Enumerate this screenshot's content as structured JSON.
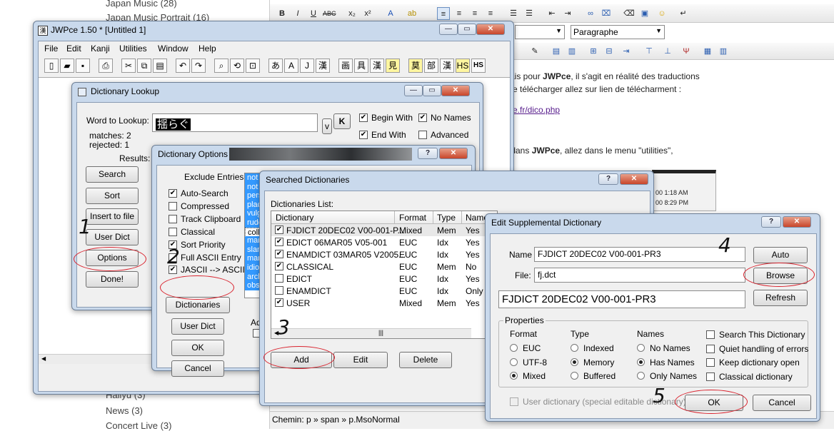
{
  "blog": {
    "categories": [
      "Japan Music (28)",
      "Japan Music Portrait (16)",
      "Hallyu (3)",
      "News (3)",
      "Concert Live (3)"
    ],
    "paragraph_select": "Paragraphe",
    "line1_pre": "çais pour ",
    "line1_bold": "JWPce",
    "line1_post": ", il s'agit en réalité des traductions",
    "line2": "r le télécharger allez sur lien de télécharment :",
    "link": "e.fr/dico.php",
    "line3_pre": "r dans ",
    "line3_bold": "JWPce",
    "line3_post": ", allez dans le menu \"utilities\",",
    "time1": "00 1:18 AM",
    "time2": "00 8:29 PM",
    "status": "Chemin: p » span » p.MsoNormal"
  },
  "jwpce": {
    "title": "JWPce 1.50 * [Untitled 1]",
    "menu": [
      "File",
      "Edit",
      "Kanji",
      "Utilities",
      "Window",
      "Help"
    ],
    "toolbar_kana": [
      "あ",
      "A",
      "J",
      "漢",
      "画",
      "具",
      "漢",
      "見",
      "莫",
      "部",
      "漢",
      "HS"
    ]
  },
  "lookup": {
    "title": "Dictionary Lookup",
    "word_label": "Word to Lookup:",
    "word_value": "揺らぐ",
    "matches": "matches: 2",
    "rejected": "rejected: 1",
    "results": "Results:",
    "v_label": "v",
    "k_label": "K",
    "begin_with": "Begin With",
    "no_names": "No Names",
    "end_with": "End With",
    "advanced": "Advanced",
    "buttons": [
      "Search",
      "Sort",
      "Insert to file",
      "User Dict",
      "Options",
      "Done!"
    ]
  },
  "options": {
    "title": "Dictionary Options",
    "exclude": "Exclude Entries:",
    "checks": [
      {
        "label": "Auto-Search",
        "checked": true
      },
      {
        "label": "Compressed",
        "checked": false
      },
      {
        "label": "Track Clipboard",
        "checked": false
      },
      {
        "label": "Classical",
        "checked": false
      },
      {
        "label": "Sort Priority",
        "checked": true
      },
      {
        "label": "Full ASCII Entry",
        "checked": false
      },
      {
        "label": "JASCII --> ASCII",
        "checked": true
      }
    ],
    "list": [
      "not",
      "not",
      "pers",
      "plac",
      "vulg",
      "rude",
      "colle",
      "mar",
      "slan",
      "mar",
      "idio",
      "arch",
      "obs"
    ],
    "ad": "Ad",
    "buttons": [
      "Dictionaries",
      "User Dict",
      "OK",
      "Cancel"
    ]
  },
  "searched": {
    "title": "Searched Dictionaries",
    "list_label": "Dictionaries List:",
    "columns": [
      "Dictionary",
      "Format",
      "Type",
      "Name"
    ],
    "rows": [
      {
        "name": "FJDICT 20DEC02 V00-001-P...",
        "format": "Mixed",
        "type": "Mem",
        "names": "Yes",
        "checked": true
      },
      {
        "name": "EDICT 06MAR05 V05-001",
        "format": "EUC",
        "type": "Idx",
        "names": "Yes",
        "checked": true
      },
      {
        "name": "ENAMDICT 03MAR05 V2005...",
        "format": "EUC",
        "type": "Idx",
        "names": "Yes",
        "checked": true
      },
      {
        "name": "CLASSICAL",
        "format": "EUC",
        "type": "Mem",
        "names": "No",
        "checked": true
      },
      {
        "name": "EDICT",
        "format": "EUC",
        "type": "Idx",
        "names": "Yes",
        "checked": false
      },
      {
        "name": "ENAMDICT",
        "format": "EUC",
        "type": "Idx",
        "names": "Only",
        "checked": false
      },
      {
        "name": "USER",
        "format": "Mixed",
        "type": "Mem",
        "names": "Yes",
        "checked": true
      }
    ],
    "buttons": [
      "Add",
      "Edit",
      "Delete"
    ]
  },
  "supp": {
    "title": "Edit Supplemental Dictionary",
    "name_label": "Name",
    "name_value": "FJDICT 20DEC02 V00-001-PR3",
    "file_label": "File:",
    "file_value": "fj.dct",
    "big_value": "FJDICT 20DEC02 V00-001-PR3",
    "buttons": {
      "auto": "Auto",
      "browse": "Browse",
      "refresh": "Refresh",
      "ok": "OK",
      "cancel": "Cancel"
    },
    "properties": "Properties",
    "format_label": "Format",
    "formats": [
      "EUC",
      "UTF-8",
      "Mixed"
    ],
    "type_label": "Type",
    "types": [
      "Indexed",
      "Memory",
      "Buffered"
    ],
    "names_label": "Names",
    "names": [
      "No Names",
      "Has Names",
      "Only Names"
    ],
    "options": [
      {
        "label": "Search This Dictionary",
        "checked": false
      },
      {
        "label": "Quiet handling of errors",
        "checked": false
      },
      {
        "label": "Keep dictionary open",
        "checked": false
      },
      {
        "label": "Classical dictionary",
        "checked": false
      }
    ],
    "user_dict": "User dictionary (special editable dictionary)"
  },
  "annotations": [
    "1",
    "2",
    "3",
    "4",
    "5"
  ]
}
